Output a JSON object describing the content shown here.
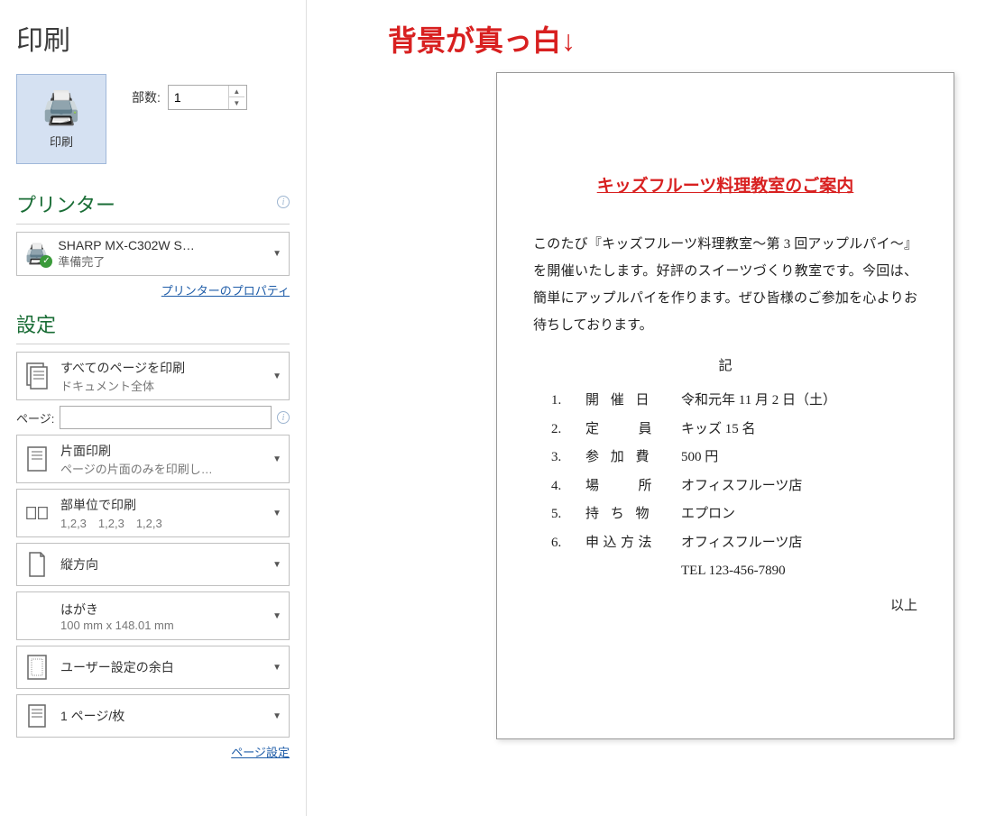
{
  "page_title": "印刷",
  "print_button_label": "印刷",
  "copies_label": "部数:",
  "copies_value": "1",
  "printer_section": "プリンター",
  "printer_name": "SHARP MX-C302W S…",
  "printer_status": "準備完了",
  "printer_props_link": "プリンターのプロパティ",
  "settings_section": "設定",
  "setting_pages_main": "すべてのページを印刷",
  "setting_pages_sub": "ドキュメント全体",
  "pages_label": "ページ:",
  "setting_sides_main": "片面印刷",
  "setting_sides_sub": "ページの片面のみを印刷し…",
  "setting_collate_main": "部単位で印刷",
  "setting_collate_sub": "1,2,3　1,2,3　1,2,3",
  "setting_orient": "縦方向",
  "setting_paper_main": "はがき",
  "setting_paper_sub": "100 mm x 148.01 mm",
  "setting_margin": "ユーザー設定の余白",
  "setting_ppp": "1 ページ/枚",
  "page_setup_link": "ページ設定",
  "annotation": "背景が真っ白↓",
  "doc": {
    "title": "キッズフルーツ料理教室のご案内",
    "body": "このたび『キッズフルーツ料理教室～第 3 回アップルパイ～』を開催いたします。好評のスイーツづくり教室です。今回は、簡単にアップルパイを作ります。ぜひ皆様のご参加を心よりお待ちしております。",
    "ki": "記",
    "items": [
      {
        "num": "1.",
        "label": "開 催 日",
        "value": "令和元年 11 月 2 日（土）"
      },
      {
        "num": "2.",
        "label": "定　　員",
        "value": "キッズ 15 名"
      },
      {
        "num": "3.",
        "label": "参 加 費",
        "value": "500 円"
      },
      {
        "num": "4.",
        "label": "場　　所",
        "value": "オフィスフルーツ店"
      },
      {
        "num": "5.",
        "label": "持 ち 物",
        "value": "エプロン"
      },
      {
        "num": "6.",
        "label": "申込方法",
        "value": "オフィスフルーツ店"
      }
    ],
    "tel": "TEL 123-456-7890",
    "ijo": "以上"
  }
}
